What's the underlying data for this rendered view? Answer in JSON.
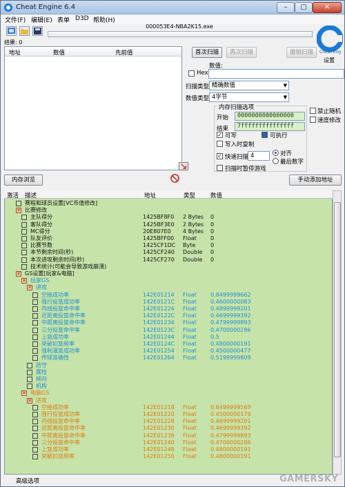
{
  "window": {
    "title": "Cheat Engine 6.4",
    "min": "–",
    "max": "▢",
    "close": "✕"
  },
  "menu": [
    "文件(F)",
    "编辑(E)",
    "表单",
    "D3D",
    "帮助(H)"
  ],
  "process_title": "000053E4-NBA2K15.exe",
  "found_label": "结果: 0",
  "result_columns": [
    "地址",
    "数值",
    "先前值"
  ],
  "scan": {
    "first_scan": "首次扫描",
    "next_scan": "再次扫描",
    "undo_scan": "撤销扫描",
    "value_label": "数值:",
    "hex_label": "Hex",
    "scan_type_label": "扫描类型",
    "scan_type_value": "精确数值",
    "value_type_label": "数值类型",
    "value_type_value": "4字节",
    "settings": "设置"
  },
  "memory_options": {
    "title": "内存扫描选项",
    "start_label": "开始",
    "start_value": "0000000000000000",
    "end_label": "结束",
    "end_value": "7fffffffffffffff",
    "writable": "可写",
    "executable": "可执行",
    "copy_on_write": "写入时复制",
    "fast_scan": "快速扫描",
    "fast_scan_value": "4",
    "align": "对齐",
    "last_digits": "最后数字",
    "pause_game": "扫描时暂停游戏",
    "disable_random": "禁止随机",
    "speedhack": "速度修改"
  },
  "buttons": {
    "memory_view": "内存浏览",
    "add_manual": "手动添加地址"
  },
  "table_columns": [
    "激活",
    "描述",
    "地址",
    "类型",
    "数值"
  ],
  "rows": [
    {
      "indent": 0,
      "kind": "cb",
      "color": "black",
      "desc": "赛程和球员设置[VC币值修改]",
      "addr": "",
      "type": "",
      "val": ""
    },
    {
      "indent": 0,
      "kind": "grp",
      "color": "black",
      "desc": "比赛修改",
      "addr": "",
      "type": "",
      "val": ""
    },
    {
      "indent": 1,
      "kind": "cb",
      "color": "black",
      "desc": "主队得分",
      "addr": "1425BF8F0",
      "type": "2 Bytes",
      "val": "0"
    },
    {
      "indent": 1,
      "kind": "cb",
      "color": "black",
      "desc": "客队得分",
      "addr": "1425BF3E0",
      "type": "2 Bytes",
      "val": "0"
    },
    {
      "indent": 1,
      "kind": "cb",
      "color": "black",
      "desc": "MC得分",
      "addr": "20E807E0",
      "type": "4 Bytes",
      "val": "0"
    },
    {
      "indent": 1,
      "kind": "cb",
      "color": "black",
      "desc": "队友评价",
      "addr": "1425BFF00",
      "type": "Float",
      "val": "0"
    },
    {
      "indent": 1,
      "kind": "cb",
      "color": "black",
      "desc": "比赛节数",
      "addr": "1425CF1DC",
      "type": "Byte",
      "val": "0"
    },
    {
      "indent": 1,
      "kind": "cb",
      "color": "black",
      "desc": "本节剩余时间(秒)",
      "addr": "1425CF240",
      "type": "Double",
      "val": "0"
    },
    {
      "indent": 1,
      "kind": "cb",
      "color": "black",
      "desc": "本次进攻剩余时间(秒)",
      "addr": "1425CF270",
      "type": "Double",
      "val": "0"
    },
    {
      "indent": 1,
      "kind": "cb",
      "color": "black",
      "desc": "技术统计(可能会导致游戏崩溃)",
      "addr": "",
      "type": "",
      "val": ""
    },
    {
      "indent": 0,
      "kind": "grp",
      "color": "black",
      "desc": "GS设置[玩家&电脑]",
      "addr": "",
      "type": "",
      "val": ""
    },
    {
      "indent": 1,
      "kind": "grp",
      "color": "blue",
      "desc": "玩家GS",
      "addr": "",
      "type": "",
      "val": ""
    },
    {
      "indent": 2,
      "kind": "grp",
      "color": "blue",
      "desc": "进攻",
      "addr": "",
      "type": "",
      "val": ""
    },
    {
      "indent": 3,
      "kind": "cb",
      "color": "blue",
      "desc": "空接成功率",
      "addr": "142E01214",
      "type": "Float",
      "val": "0.8499999662"
    },
    {
      "indent": 3,
      "kind": "cb",
      "color": "blue",
      "desc": "强行投篮成功率",
      "addr": "142E0121C",
      "type": "Float",
      "val": "0.4600000083"
    },
    {
      "indent": 3,
      "kind": "cb",
      "color": "blue",
      "desc": "内线投篮命中率",
      "addr": "142E01224",
      "type": "Float",
      "val": "0.4899999201"
    },
    {
      "indent": 3,
      "kind": "cb",
      "color": "blue",
      "desc": "近距离投篮命中率",
      "addr": "142E0122C",
      "type": "Float",
      "val": "0.4699999392"
    },
    {
      "indent": 3,
      "kind": "cb",
      "color": "blue",
      "desc": "中距离投篮命中率",
      "addr": "142E01234",
      "type": "Float",
      "val": "0.4799999893"
    },
    {
      "indent": 3,
      "kind": "cb",
      "color": "blue",
      "desc": "三分投篮命中率",
      "addr": "142E0123C",
      "type": "Float",
      "val": "0.4700000286"
    },
    {
      "indent": 3,
      "kind": "cb",
      "color": "blue",
      "desc": "上篮成功率",
      "addr": "142E01244",
      "type": "Float",
      "val": "0.5"
    },
    {
      "indent": 3,
      "kind": "cb",
      "color": "blue",
      "desc": "突破扣篮频率",
      "addr": "142E0124C",
      "type": "Float",
      "val": "0.4800000191"
    },
    {
      "indent": 3,
      "kind": "cb",
      "color": "blue",
      "desc": "强制灌篮成功率",
      "addr": "142E01254",
      "type": "Float",
      "val": "0.4500000477"
    },
    {
      "indent": 3,
      "kind": "cb",
      "color": "blue",
      "desc": "传球准确性",
      "addr": "142E01264",
      "type": "Float",
      "val": "0.5199999809"
    },
    {
      "indent": 2,
      "kind": "cb",
      "color": "blue",
      "desc": "防守",
      "addr": "",
      "type": "",
      "val": ""
    },
    {
      "indent": 2,
      "kind": "cb",
      "color": "blue",
      "desc": "属性",
      "addr": "",
      "type": "",
      "val": ""
    },
    {
      "indent": 2,
      "kind": "cb",
      "color": "blue",
      "desc": "倾向",
      "addr": "",
      "type": "",
      "val": ""
    },
    {
      "indent": 2,
      "kind": "cb",
      "color": "blue",
      "desc": "机构",
      "addr": "",
      "type": "",
      "val": ""
    },
    {
      "indent": 1,
      "kind": "grp",
      "color": "orange",
      "desc": "电脑GS",
      "addr": "",
      "type": "",
      "val": ""
    },
    {
      "indent": 2,
      "kind": "grp",
      "color": "orange",
      "desc": "进攻",
      "addr": "",
      "type": "",
      "val": ""
    },
    {
      "indent": 3,
      "kind": "cb",
      "color": "orange",
      "desc": "空接成功率",
      "addr": "142E01218",
      "type": "Float",
      "val": "0.6499999569"
    },
    {
      "indent": 3,
      "kind": "cb",
      "color": "orange",
      "desc": "强行投篮成功率",
      "addr": "142E01220",
      "type": "Float",
      "val": "0.4500000179"
    },
    {
      "indent": 3,
      "kind": "cb",
      "color": "orange",
      "desc": "内线投篮命中率",
      "addr": "142E01228",
      "type": "Float",
      "val": "0.4699999201"
    },
    {
      "indent": 3,
      "kind": "cb",
      "color": "orange",
      "desc": "近距离投篮命中率",
      "addr": "142E01230",
      "type": "Float",
      "val": "0.4699999392"
    },
    {
      "indent": 3,
      "kind": "cb",
      "color": "orange",
      "desc": "中距离投篮命中率",
      "addr": "142E01238",
      "type": "Float",
      "val": "0.4799999893"
    },
    {
      "indent": 3,
      "kind": "cb",
      "color": "orange",
      "desc": "三分投篮命中率",
      "addr": "142E01240",
      "type": "Float",
      "val": "0.4700000286"
    },
    {
      "indent": 3,
      "kind": "cb",
      "color": "orange",
      "desc": "上篮成功率",
      "addr": "142E01248",
      "type": "Float",
      "val": "0.4800000191"
    },
    {
      "indent": 3,
      "kind": "cb",
      "color": "orange",
      "desc": "突破扣篮频率",
      "addr": "142E01250",
      "type": "Float",
      "val": "0.4800000191"
    }
  ],
  "advanced_options": "高级选项",
  "watermark": "GAMERSKY",
  "colors": {
    "table_bg": "#c6e3a9",
    "blue_text": "#1d8fd0",
    "orange_text": "#e07a10",
    "hex_field_bg": "#d8f0c8"
  }
}
